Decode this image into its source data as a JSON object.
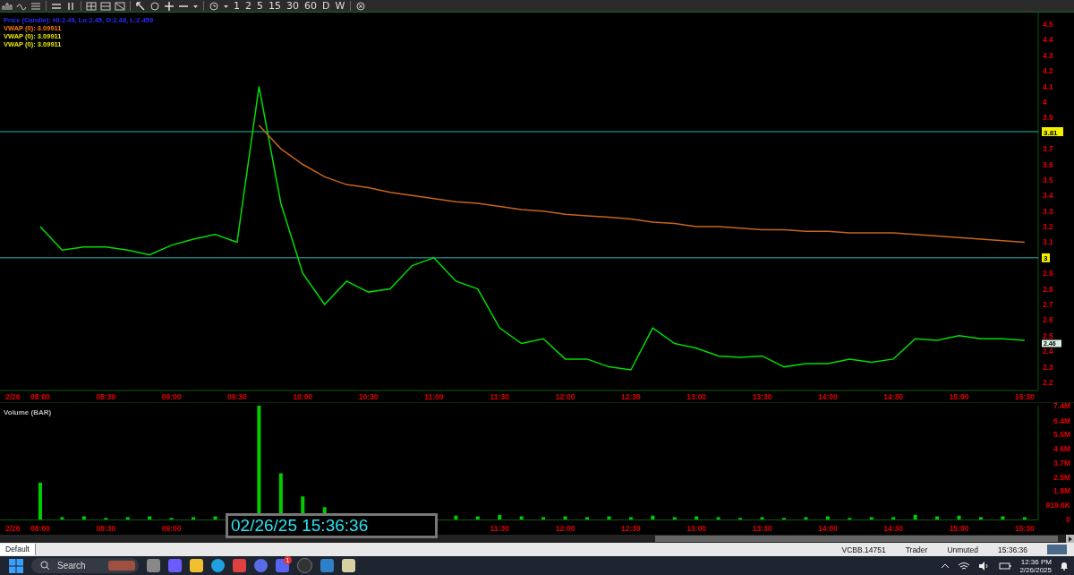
{
  "toolbar": {
    "intervals": [
      {
        "label": "1"
      },
      {
        "label": "2"
      },
      {
        "label": "5"
      },
      {
        "label": "15"
      },
      {
        "label": "30"
      },
      {
        "label": "60"
      },
      {
        "label": "D"
      },
      {
        "label": "W"
      }
    ]
  },
  "price_chart": {
    "legend": [
      {
        "text": "Price (Candle): Hi:2.49, Lo:2.45, O:2.48, L:2.459",
        "color": "#2b2bff"
      },
      {
        "text": "VWAP (0): 3.09911",
        "color": "#ff7a00"
      },
      {
        "text": "VWAP (0): 3.09911",
        "color": "#e6e600"
      },
      {
        "text": "VWAP (0): 3.09911",
        "color": "#e6e600"
      }
    ],
    "date_label": "2/26",
    "last_price_tag": "2.46",
    "chart_data": {
      "type": "line",
      "x": [
        480,
        490,
        500,
        510,
        520,
        530,
        540,
        550,
        560,
        570,
        580,
        590,
        600,
        610,
        620,
        630,
        640,
        650,
        660,
        670,
        680,
        690,
        700,
        710,
        720,
        730,
        740,
        750,
        760,
        770,
        780,
        790,
        800,
        810,
        820,
        830,
        840,
        850,
        860,
        870,
        880,
        890,
        900,
        910,
        920,
        930
      ],
      "xlim": [
        461.6,
        936.2
      ],
      "series": [
        {
          "color": "#00dd00",
          "values": [
            3.2,
            3.05,
            3.07,
            3.07,
            3.05,
            3.02,
            3.08,
            3.12,
            3.15,
            3.1,
            4.1,
            3.35,
            2.9,
            2.7,
            2.85,
            2.78,
            2.8,
            2.95,
            3.0,
            2.85,
            2.8,
            2.55,
            2.45,
            2.48,
            2.35,
            2.35,
            2.3,
            2.28,
            2.55,
            2.45,
            2.42,
            2.37,
            2.36,
            2.37,
            2.3,
            2.32,
            2.32,
            2.35,
            2.33,
            2.35,
            2.48,
            2.47,
            2.5,
            2.48,
            2.48,
            2.47
          ]
        },
        {
          "color": "#c8641a",
          "values": [
            null,
            null,
            null,
            null,
            null,
            null,
            null,
            null,
            null,
            null,
            3.85,
            3.7,
            3.6,
            3.52,
            3.47,
            3.45,
            3.42,
            3.4,
            3.38,
            3.36,
            3.35,
            3.33,
            3.31,
            3.3,
            3.28,
            3.27,
            3.26,
            3.25,
            3.23,
            3.22,
            3.2,
            3.2,
            3.19,
            3.18,
            3.18,
            3.17,
            3.17,
            3.16,
            3.16,
            3.16,
            3.15,
            3.14,
            3.13,
            3.12,
            3.11,
            3.1
          ]
        }
      ],
      "ylim": [
        2.148,
        4.575
      ],
      "xticks": [
        {
          "value": 480,
          "label": "08:00"
        },
        {
          "value": 510,
          "label": "08:30"
        },
        {
          "value": 540,
          "label": "09:00"
        },
        {
          "value": 570,
          "label": "09:30"
        },
        {
          "value": 600,
          "label": "10:00"
        },
        {
          "value": 630,
          "label": "10:30"
        },
        {
          "value": 660,
          "label": "11:00"
        },
        {
          "value": 690,
          "label": "11:30"
        },
        {
          "value": 720,
          "label": "12:00"
        },
        {
          "value": 750,
          "label": "12:30"
        },
        {
          "value": 780,
          "label": "13:00"
        },
        {
          "value": 810,
          "label": "13:30"
        },
        {
          "value": 840,
          "label": "14:00"
        },
        {
          "value": 870,
          "label": "14:30"
        },
        {
          "value": 900,
          "label": "15:00"
        },
        {
          "value": 930,
          "label": "15:30"
        }
      ],
      "yticks": [
        2.2,
        2.3,
        2.4,
        2.5,
        2.6,
        2.7,
        2.8,
        2.9,
        3.1,
        3.2,
        3.3,
        3.4,
        3.5,
        3.6,
        3.7,
        3.9,
        4,
        4.1,
        4.2,
        4.3,
        4.4,
        4.5
      ],
      "ref_lines": [
        {
          "axis": "y",
          "value": 3.81,
          "label": "3.81"
        },
        {
          "axis": "y",
          "value": 3,
          "label": "3"
        }
      ]
    }
  },
  "volume_chart": {
    "title": "Volume (BAR)",
    "date_label": "2/26",
    "chart_data": {
      "type": "bar",
      "x": [
        480,
        490,
        500,
        510,
        520,
        530,
        540,
        550,
        560,
        580,
        590,
        600,
        610,
        670,
        680,
        690,
        700,
        710,
        720,
        730,
        740,
        750,
        760,
        770,
        780,
        790,
        800,
        810,
        820,
        830,
        840,
        850,
        860,
        870,
        880,
        890,
        900,
        910,
        920,
        930
      ],
      "xlim": [
        461.6,
        936.2
      ],
      "series": [
        {
          "color": "#00cc00",
          "values": [
            2400000,
            150000,
            200000,
            100000,
            150000,
            200000,
            100000,
            150000,
            200000,
            7400000,
            3000000,
            1500000,
            800000,
            250000,
            200000,
            300000,
            200000,
            150000,
            200000,
            150000,
            200000,
            150000,
            250000,
            150000,
            200000,
            150000,
            100000,
            150000,
            100000,
            150000,
            200000,
            100000,
            150000,
            150000,
            300000,
            200000,
            250000,
            150000,
            200000,
            150000
          ]
        }
      ],
      "ylim": [
        0,
        7400000
      ],
      "xticks": [
        {
          "value": 480,
          "label": "08:00"
        },
        {
          "value": 510,
          "label": "08:30"
        },
        {
          "value": 540,
          "label": "09:00"
        },
        {
          "value": 690,
          "label": "11:30"
        },
        {
          "value": 720,
          "label": "12:00"
        },
        {
          "value": 750,
          "label": "12:30"
        },
        {
          "value": 780,
          "label": "13:00"
        },
        {
          "value": 810,
          "label": "13:30"
        },
        {
          "value": 840,
          "label": "14:00"
        },
        {
          "value": 870,
          "label": "14:30"
        },
        {
          "value": 900,
          "label": "15:00"
        },
        {
          "value": 930,
          "label": "15:30"
        }
      ],
      "yticks": [
        {
          "value": 0,
          "label": "0"
        },
        {
          "value": 919600,
          "label": "919.6K"
        },
        {
          "value": 1839200,
          "label": "1.8M"
        },
        {
          "value": 2758800,
          "label": "2.8M"
        },
        {
          "value": 3678400,
          "label": "3.7M"
        },
        {
          "value": 4598000,
          "label": "4.6M"
        },
        {
          "value": 5517600,
          "label": "5.5M"
        },
        {
          "value": 6437200,
          "label": "6.4M"
        },
        {
          "value": 7400000,
          "label": "7.4M"
        }
      ]
    }
  },
  "timestamp_overlay": "02/26/25 15:36:36",
  "status_bar": {
    "layout": "Default",
    "account": "VCBB.14751",
    "mode": "Trader",
    "sound": "Unmuted",
    "time": "15:36:36"
  },
  "taskbar": {
    "search_placeholder": "Search",
    "chat_badge": "1",
    "time": "12:36 PM",
    "date": "2/26/2025"
  }
}
